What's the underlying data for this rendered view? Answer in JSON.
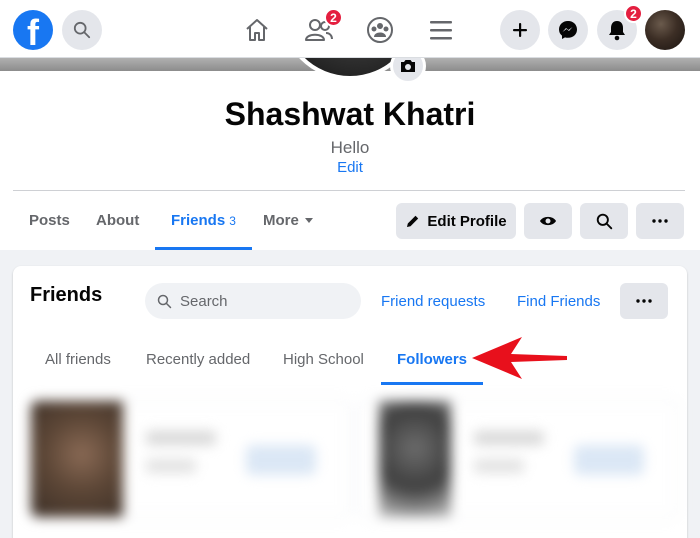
{
  "nav": {
    "logo_letter": "f",
    "friends_badge": "2",
    "notifications_badge": "2"
  },
  "profile": {
    "name": "Shashwat Khatri",
    "bio": "Hello",
    "bio_edit": "Edit"
  },
  "profile_tabs": [
    {
      "label": "Posts"
    },
    {
      "label": "About"
    },
    {
      "label": "Friends",
      "count": "3"
    },
    {
      "label": "More"
    }
  ],
  "actions": {
    "edit_profile": "Edit Profile"
  },
  "friends_section": {
    "title": "Friends",
    "search_placeholder": "Search",
    "friend_requests": "Friend requests",
    "find_friends": "Find Friends",
    "tabs": [
      {
        "label": "All friends"
      },
      {
        "label": "Recently added"
      },
      {
        "label": "High School"
      },
      {
        "label": "Followers"
      }
    ]
  },
  "colors": {
    "accent": "#1877f2",
    "badge": "#e41e3f",
    "annotation_arrow": "#e8101c"
  }
}
